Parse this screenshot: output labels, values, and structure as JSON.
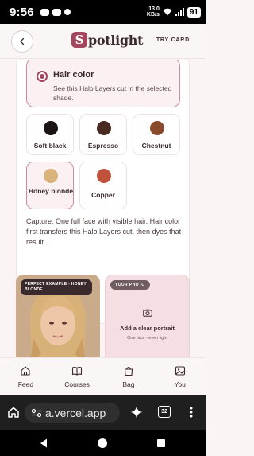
{
  "status_bar": {
    "time": "9:56",
    "net_speed_value": "13.0",
    "net_speed_unit": "KB/s",
    "battery": "91"
  },
  "header": {
    "brand_initial": "S",
    "brand_rest": "potlight",
    "right_action": "TRY CARD"
  },
  "option": {
    "title": "Hair color",
    "description": "See this Halo Layers cut in the selected shade."
  },
  "swatches": [
    {
      "label": "Soft black",
      "color": "#1a1414"
    },
    {
      "label": "Espresso",
      "color": "#4a2b22"
    },
    {
      "label": "Chestnut",
      "color": "#8a4a2c"
    },
    {
      "label": "Honey blonde",
      "color": "#d9b27c",
      "selected": true
    },
    {
      "label": "Copper",
      "color": "#c0513a"
    }
  ],
  "caption": "Capture: One full face with visible hair. Hair color first transfers this Halo Layers cut, then dyes that result.",
  "example": {
    "tag": "PERFECT EXAMPLE - HONEY BLONDE"
  },
  "your_photo": {
    "tag": "YOUR PHOTO",
    "title": "Add a clear portrait",
    "subtitle": "One face - even light"
  },
  "bottom_nav": [
    {
      "label": "Feed",
      "icon": "home-icon"
    },
    {
      "label": "Courses",
      "icon": "book-icon"
    },
    {
      "label": "Bag",
      "icon": "bag-icon"
    },
    {
      "label": "You",
      "icon": "image-icon"
    }
  ],
  "browser": {
    "url": "a.vercel.app",
    "tab_count": "32"
  },
  "colors": {
    "accent": "#a3455c",
    "selected_border": "#cf8c9c",
    "selected_bg": "#fcf1f2"
  }
}
